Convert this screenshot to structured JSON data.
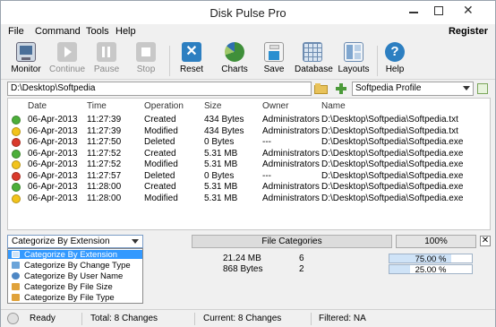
{
  "window": {
    "title": "Disk Pulse Pro"
  },
  "menu": {
    "items": [
      "File",
      "Command",
      "Tools",
      "Help"
    ],
    "register": "Register"
  },
  "toolbar": {
    "monitor": "Monitor",
    "continue": "Continue",
    "pause": "Pause",
    "stop": "Stop",
    "reset": "Reset",
    "charts": "Charts",
    "save": "Save",
    "database": "Database",
    "layouts": "Layouts",
    "help": "Help"
  },
  "path": {
    "value": "D:\\Desktop\\Softpedia",
    "profile": "Softpedia Profile"
  },
  "table": {
    "headers": [
      "Date",
      "Time",
      "Operation",
      "Size",
      "Owner",
      "Name"
    ],
    "rows": [
      {
        "status": "green",
        "date": "06-Apr-2013",
        "time": "11:27:39",
        "operation": "Created",
        "size": "434 Bytes",
        "owner": "Administrators",
        "name": "D:\\Desktop\\Softpedia\\Softpedia.txt"
      },
      {
        "status": "yellow",
        "date": "06-Apr-2013",
        "time": "11:27:39",
        "operation": "Modified",
        "size": "434 Bytes",
        "owner": "Administrators",
        "name": "D:\\Desktop\\Softpedia\\Softpedia.txt"
      },
      {
        "status": "red",
        "date": "06-Apr-2013",
        "time": "11:27:50",
        "operation": "Deleted",
        "size": "0 Bytes",
        "owner": "---",
        "name": "D:\\Desktop\\Softpedia\\Softpedia.exe"
      },
      {
        "status": "green",
        "date": "06-Apr-2013",
        "time": "11:27:52",
        "operation": "Created",
        "size": "5.31 MB",
        "owner": "Administrators",
        "name": "D:\\Desktop\\Softpedia\\Softpedia.exe"
      },
      {
        "status": "yellow",
        "date": "06-Apr-2013",
        "time": "11:27:52",
        "operation": "Modified",
        "size": "5.31 MB",
        "owner": "Administrators",
        "name": "D:\\Desktop\\Softpedia\\Softpedia.exe"
      },
      {
        "status": "red",
        "date": "06-Apr-2013",
        "time": "11:27:57",
        "operation": "Deleted",
        "size": "0 Bytes",
        "owner": "---",
        "name": "D:\\Desktop\\Softpedia\\Softpedia.exe"
      },
      {
        "status": "green",
        "date": "06-Apr-2013",
        "time": "11:28:00",
        "operation": "Created",
        "size": "5.31 MB",
        "owner": "Administrators",
        "name": "D:\\Desktop\\Softpedia\\Softpedia.exe"
      },
      {
        "status": "yellow",
        "date": "06-Apr-2013",
        "time": "11:28:00",
        "operation": "Modified",
        "size": "5.31 MB",
        "owner": "Administrators",
        "name": "D:\\Desktop\\Softpedia\\Softpedia.exe"
      }
    ]
  },
  "categories": {
    "selected": "Categorize By Extension",
    "header": "File Categories",
    "total_percent": "100%",
    "options": [
      "Categorize By Extension",
      "Categorize By Change Type",
      "Categorize By User Name",
      "Categorize By File Size",
      "Categorize By File Type"
    ],
    "summary": [
      {
        "size": "21.24 MB",
        "count": "6",
        "percent_label": "75.00 %",
        "percent": 75
      },
      {
        "size": "868 Bytes",
        "count": "2",
        "percent_label": "25.00 %",
        "percent": 25
      }
    ]
  },
  "status": {
    "state": "Ready",
    "total": "Total: 8 Changes",
    "current": "Current: 8 Changes",
    "filtered": "Filtered: NA"
  },
  "colors": {
    "green": "#4caf3a",
    "yellow": "#f2c31b",
    "red": "#d93a2b",
    "accent": "#3399ff"
  }
}
